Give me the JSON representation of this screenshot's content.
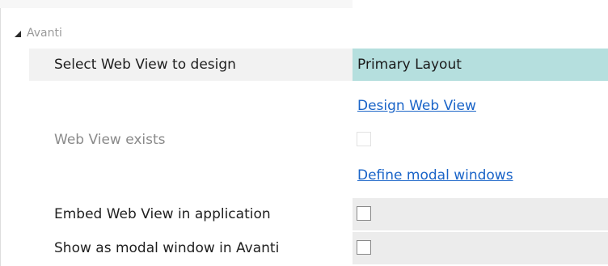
{
  "group": {
    "label": "Avanti"
  },
  "fields": {
    "select_web_view": {
      "label": "Select Web View to design",
      "value": "Primary Layout"
    },
    "design_link": "Design Web View",
    "web_view_exists": {
      "label": "Web View exists",
      "checked": false,
      "disabled": true
    },
    "define_modal_link": "Define modal windows",
    "embed_web_view": {
      "label": "Embed Web View in application",
      "checked": false
    },
    "show_modal": {
      "label": "Show as modal window in Avanti",
      "checked": false
    }
  },
  "colors": {
    "select_bg": "#b5dfde",
    "link": "#1a64c8",
    "value_shade": "#ececec"
  }
}
